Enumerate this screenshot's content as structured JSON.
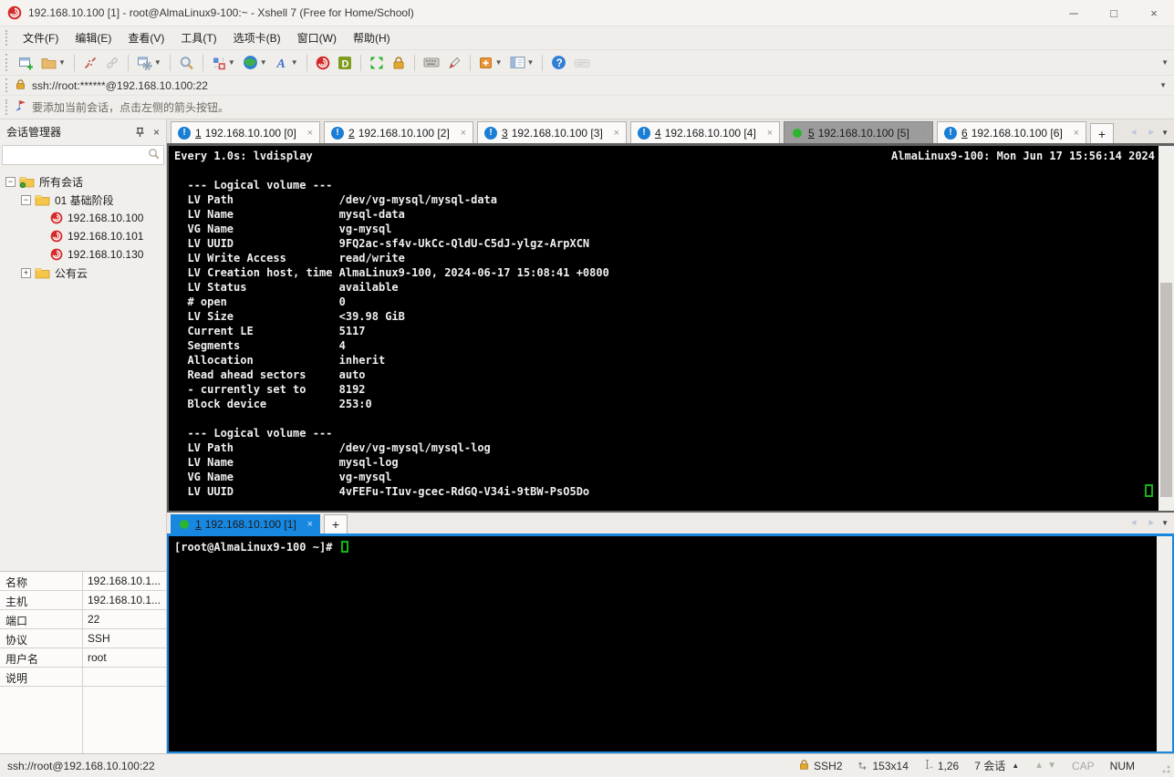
{
  "window": {
    "title": "192.168.10.100 [1] - root@AlmaLinux9-100:~ - Xshell 7 (Free for Home/School)"
  },
  "icons": {
    "minimize": "─",
    "maximize": "□",
    "close": "×",
    "tab_close": "×",
    "tab_add": "+",
    "caret_down": "▼",
    "caret_up": "▲",
    "nav_left": "◂",
    "nav_right": "▸",
    "expander_collapse": "−",
    "expander_expand": "+",
    "alert_glyph": "!",
    "pin_label": "pin",
    "search_label": "search"
  },
  "menu": {
    "items": [
      "文件(F)",
      "编辑(E)",
      "查看(V)",
      "工具(T)",
      "选项卡(B)",
      "窗口(W)",
      "帮助(H)"
    ]
  },
  "toolbar": {
    "groups": [
      [
        {
          "name": "new-session",
          "dropdown": false
        },
        {
          "name": "open-session",
          "dropdown": true
        }
      ],
      [
        {
          "name": "disconnect",
          "dropdown": false
        },
        {
          "name": "reconnect",
          "dropdown": false,
          "disabled": true
        }
      ],
      [
        {
          "name": "session-properties",
          "dropdown": true
        }
      ],
      [
        {
          "name": "find",
          "dropdown": false
        }
      ],
      [
        {
          "name": "color-scheme",
          "dropdown": true
        },
        {
          "name": "web-browser",
          "dropdown": true
        },
        {
          "name": "font",
          "dropdown": true
        }
      ],
      [
        {
          "name": "xshell",
          "dropdown": false
        },
        {
          "name": "xftp",
          "dropdown": false
        }
      ],
      [
        {
          "name": "fullscreen",
          "dropdown": false
        },
        {
          "name": "lock-screen",
          "dropdown": false
        }
      ],
      [
        {
          "name": "virtual-keyboard",
          "dropdown": false
        },
        {
          "name": "highlight-pen",
          "dropdown": false
        }
      ],
      [
        {
          "name": "new-tab",
          "dropdown": true
        },
        {
          "name": "split-view",
          "dropdown": true
        }
      ],
      [
        {
          "name": "help",
          "dropdown": false
        },
        {
          "name": "compose-bar",
          "dropdown": false,
          "disabled": true
        }
      ]
    ]
  },
  "address_bar": {
    "value": "ssh://root:******@192.168.10.100:22"
  },
  "notification": {
    "text": "要添加当前会话，点击左侧的箭头按钮。"
  },
  "tabs": {
    "top": [
      {
        "num": "1",
        "host": "192.168.10.100 [0]",
        "state": "alert"
      },
      {
        "num": "2",
        "host": "192.168.10.100 [2]",
        "state": "alert"
      },
      {
        "num": "3",
        "host": "192.168.10.100 [3]",
        "state": "alert"
      },
      {
        "num": "4",
        "host": "192.168.10.100 [4]",
        "state": "alert"
      },
      {
        "num": "5",
        "host": "192.168.10.100 [5]",
        "state": "active"
      },
      {
        "num": "6",
        "host": "192.168.10.100 [6]",
        "state": "alert"
      }
    ],
    "bottom": [
      {
        "num": "1",
        "host": "192.168.10.100 [1]",
        "state": "active"
      }
    ]
  },
  "sidebar": {
    "title": "会话管理器",
    "search_value": "",
    "tree": [
      {
        "label": "所有会话",
        "kind": "folder-root",
        "expander": "−",
        "indent": 0
      },
      {
        "label": "01 基础阶段",
        "kind": "folder",
        "expander": "−",
        "indent": 1
      },
      {
        "label": "192.168.10.100",
        "kind": "session",
        "expander": null,
        "indent": 2
      },
      {
        "label": "192.168.10.101",
        "kind": "session",
        "expander": null,
        "indent": 2
      },
      {
        "label": "192.168.10.130",
        "kind": "session",
        "expander": null,
        "indent": 2
      },
      {
        "label": "公有云",
        "kind": "folder",
        "expander": "+",
        "indent": 1
      }
    ],
    "properties": [
      {
        "label": "名称",
        "value": "192.168.10.1..."
      },
      {
        "label": "主机",
        "value": "192.168.10.1..."
      },
      {
        "label": "端口",
        "value": "22"
      },
      {
        "label": "协议",
        "value": "SSH"
      },
      {
        "label": "用户名",
        "value": "root"
      },
      {
        "label": "说明",
        "value": ""
      }
    ]
  },
  "terminal_top": {
    "header_left": "Every 1.0s: lvdisplay",
    "header_right": "AlmaLinux9-100: Mon Jun 17 15:56:14 2024",
    "lines": [
      "",
      "  --- Logical volume ---",
      "  LV Path                /dev/vg-mysql/mysql-data",
      "  LV Name                mysql-data",
      "  VG Name                vg-mysql",
      "  LV UUID                9FQ2ac-sf4v-UkCc-QldU-C5dJ-ylgz-ArpXCN",
      "  LV Write Access        read/write",
      "  LV Creation host, time AlmaLinux9-100, 2024-06-17 15:08:41 +0800",
      "  LV Status              available",
      "  # open                 0",
      "  LV Size                <39.98 GiB",
      "  Current LE             5117",
      "  Segments               4",
      "  Allocation             inherit",
      "  Read ahead sectors     auto",
      "  - currently set to     8192",
      "  Block device           253:0",
      "",
      "  --- Logical volume ---",
      "  LV Path                /dev/vg-mysql/mysql-log",
      "  LV Name                mysql-log",
      "  VG Name                vg-mysql",
      "  LV UUID                4vFEFu-TIuv-gcec-RdGQ-V34i-9tBW-PsO5Do"
    ]
  },
  "terminal_bottom": {
    "prompt": "[root@AlmaLinux9-100 ~]# "
  },
  "status_bar": {
    "left": "ssh://root@192.168.10.100:22",
    "protocol": "SSH2",
    "terminal_size": "153x14",
    "cursor_pos": "1,26",
    "sessions": "7 会话",
    "cap": "CAP",
    "num": "NUM"
  },
  "colors": {
    "accent_blue": "#1787e0",
    "active_tab_gray": "#9c9c9c",
    "terminal_bg": "#000000",
    "terminal_fg": "#f0f0f0",
    "cursor_green": "#13b413",
    "alert_blue": "#1a7fd4",
    "connected_green": "#2db52d"
  }
}
